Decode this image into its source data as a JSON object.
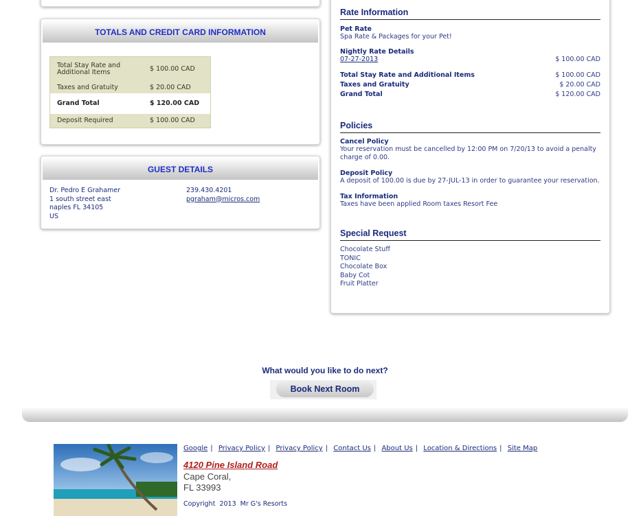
{
  "totals": {
    "title": "TOTALS AND CREDIT CARD INFORMATION",
    "rows": [
      {
        "label": "Total Stay Rate and Additional Items",
        "value": "$ 100.00 CAD"
      },
      {
        "label": "Taxes and Gratuity",
        "value": "$ 20.00 CAD"
      },
      {
        "label": "Grand Total",
        "value": "$ 120.00 CAD"
      },
      {
        "label": "Deposit Required",
        "value": "$ 100.00 CAD"
      }
    ]
  },
  "guest": {
    "title": "GUEST DETAILS",
    "name": "Dr. Pedro E Grahamer",
    "street": "1 south street east",
    "city": "naples FL 34105",
    "country": "US",
    "phone": "239.430.4201",
    "email": "pgraham@micros.com"
  },
  "rate": {
    "title": "Rate Information",
    "pet_label": "Pet Rate",
    "pet_desc": "Spa Rate & Packages for your Pet!",
    "nightly_label": "Nightly Rate Details",
    "nightly_date": "07-27-2013",
    "nightly_value": "$ 100.00 CAD",
    "stay_label": "Total Stay Rate and Additional Items",
    "stay_value": "$ 100.00 CAD",
    "tax_label": "Taxes and Gratuity",
    "tax_value": "$ 20.00 CAD",
    "grand_label": "Grand Total",
    "grand_value": "$ 120.00 CAD"
  },
  "policies": {
    "title": "Policies",
    "cancel_label": "Cancel Policy",
    "cancel_text": "Your reservation must be cancelled by 12:00 PM on 7/20/13 to avoid a penalty charge of 0.00.",
    "deposit_label": "Deposit Policy",
    "deposit_text": "A deposit of 100.00 is due by 27-JUL-13 in order to guarantee your reservation.",
    "tax_label": "Tax Information",
    "tax_text": "Taxes have been applied Room taxes Resort Fee"
  },
  "special": {
    "title": "Special Request",
    "items": [
      "Chocolate Stuff",
      "TONIC",
      "Chocolate Box",
      "Baby Cot",
      "Fruit Platter"
    ]
  },
  "next": {
    "prompt": "What would you like to do next?",
    "button": "Book Next Room"
  },
  "footer": {
    "links": [
      "Google",
      "Privacy Policy",
      "Privacy Policy",
      "Contact Us",
      "About Us",
      "Location & Directions",
      "Site Map"
    ],
    "address_line1": "4120 Pine Island Road",
    "address_line2": "Cape Coral,",
    "address_line3": "FL 33993",
    "copyright": "Copyright  2013  Mr G's Resorts"
  }
}
